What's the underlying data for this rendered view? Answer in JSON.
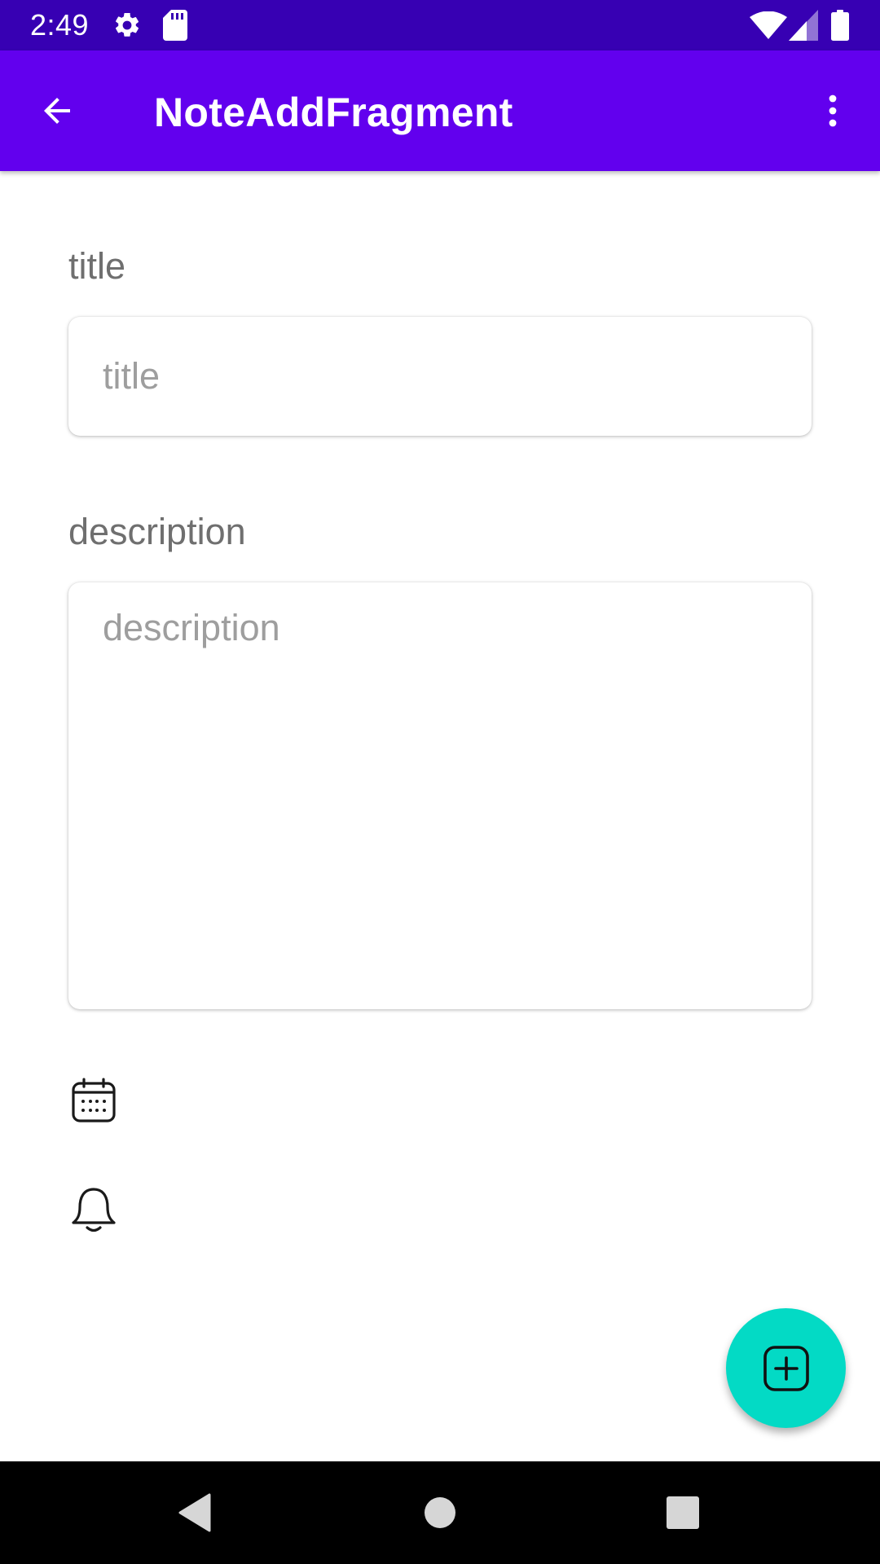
{
  "status_bar": {
    "time": "2:49",
    "icons": [
      "gear-icon",
      "sd-card-icon",
      "wifi-icon",
      "signal-icon",
      "battery-icon"
    ],
    "color": "#3700b3"
  },
  "app_bar": {
    "title": "NoteAddFragment",
    "color": "#6200ee",
    "icons": [
      "arrow-back-icon",
      "more-vert-icon"
    ]
  },
  "form": {
    "title_label": "title",
    "title_placeholder": "title",
    "title_value": "",
    "description_label": "description",
    "description_placeholder": "description",
    "description_value": ""
  },
  "actions": {
    "icons": [
      "calendar-icon",
      "bell-icon"
    ]
  },
  "fab": {
    "icon": "add-box-icon",
    "color": "#03dac5"
  },
  "nav_bar": {
    "icons": [
      "nav-back-icon",
      "nav-home-icon",
      "nav-recents-icon"
    ]
  }
}
